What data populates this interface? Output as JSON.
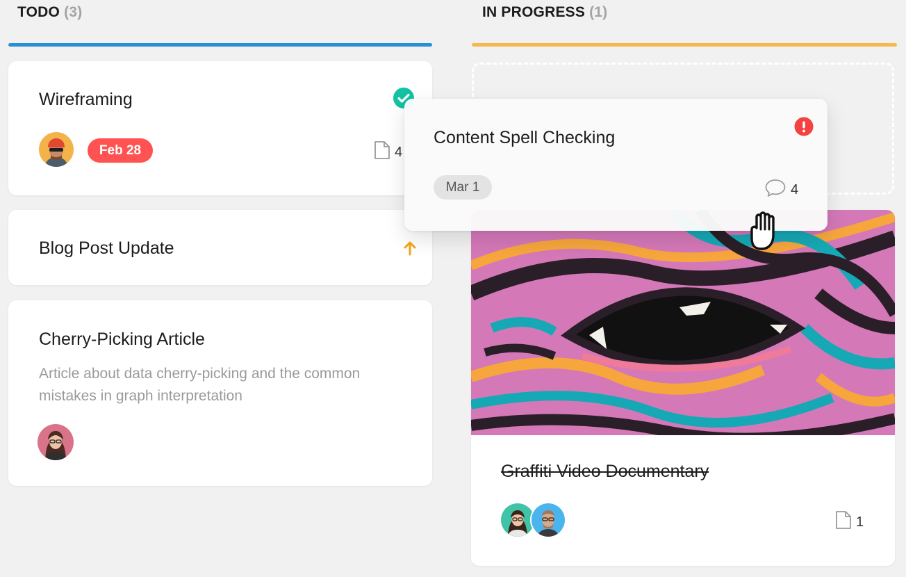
{
  "columns": [
    {
      "title": "TODO",
      "count": "(3)",
      "accent": "#2b8fd6"
    },
    {
      "title": "IN PROGRESS",
      "count": "(1)",
      "accent": "#f6b94f"
    }
  ],
  "todo": {
    "wireframing": {
      "title": "Wireframing",
      "date": "Feb 28",
      "date_color": "#ff5252",
      "status_icon": "check-circle-icon",
      "attachments": "4"
    },
    "blog": {
      "title": "Blog Post Update",
      "priority_icon": "arrow-up-icon"
    },
    "cherry": {
      "title": "Cherry-Picking Article",
      "description": "Article about data cherry-picking and the common mistakes in graph interpretation"
    }
  },
  "dragging": {
    "title": "Content Spell Checking",
    "date": "Mar 1",
    "comments": "4",
    "status_icon": "alert-icon",
    "status_color": "#f44141"
  },
  "in_progress": {
    "graffiti": {
      "title": "Graffiti Video Documentary",
      "attachments": "1"
    }
  }
}
